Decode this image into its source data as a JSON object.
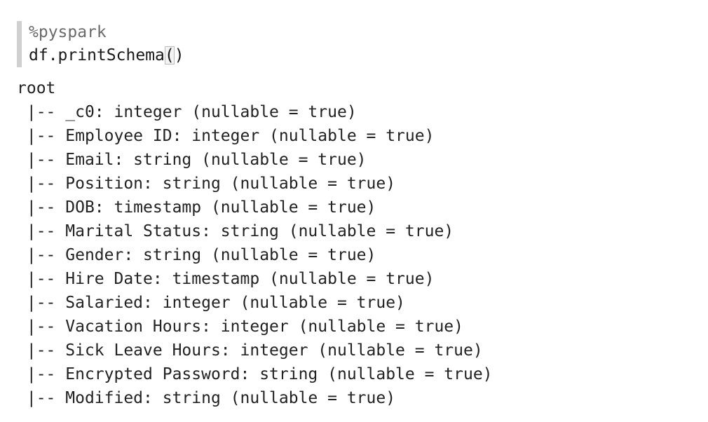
{
  "input": {
    "lines": [
      "%pyspark",
      "df.printSchema()"
    ],
    "magic": "%pyspark",
    "code_prefix": "df.printSchema",
    "paren_open": "(",
    "paren_close": ")"
  },
  "output": {
    "root_label": "root",
    "tree_prefix": " |-- ",
    "fields": [
      "_c0: integer (nullable = true)",
      "Employee ID: integer (nullable = true)",
      "Email: string (nullable = true)",
      "Position: string (nullable = true)",
      "DOB: timestamp (nullable = true)",
      "Marital Status: string (nullable = true)",
      "Gender: string (nullable = true)",
      "Hire Date: timestamp (nullable = true)",
      "Salaried: integer (nullable = true)",
      "Vacation Hours: integer (nullable = true)",
      "Sick Leave Hours: integer (nullable = true)",
      "Encrypted Password: string (nullable = true)",
      "Modified: string (nullable = true)"
    ]
  }
}
